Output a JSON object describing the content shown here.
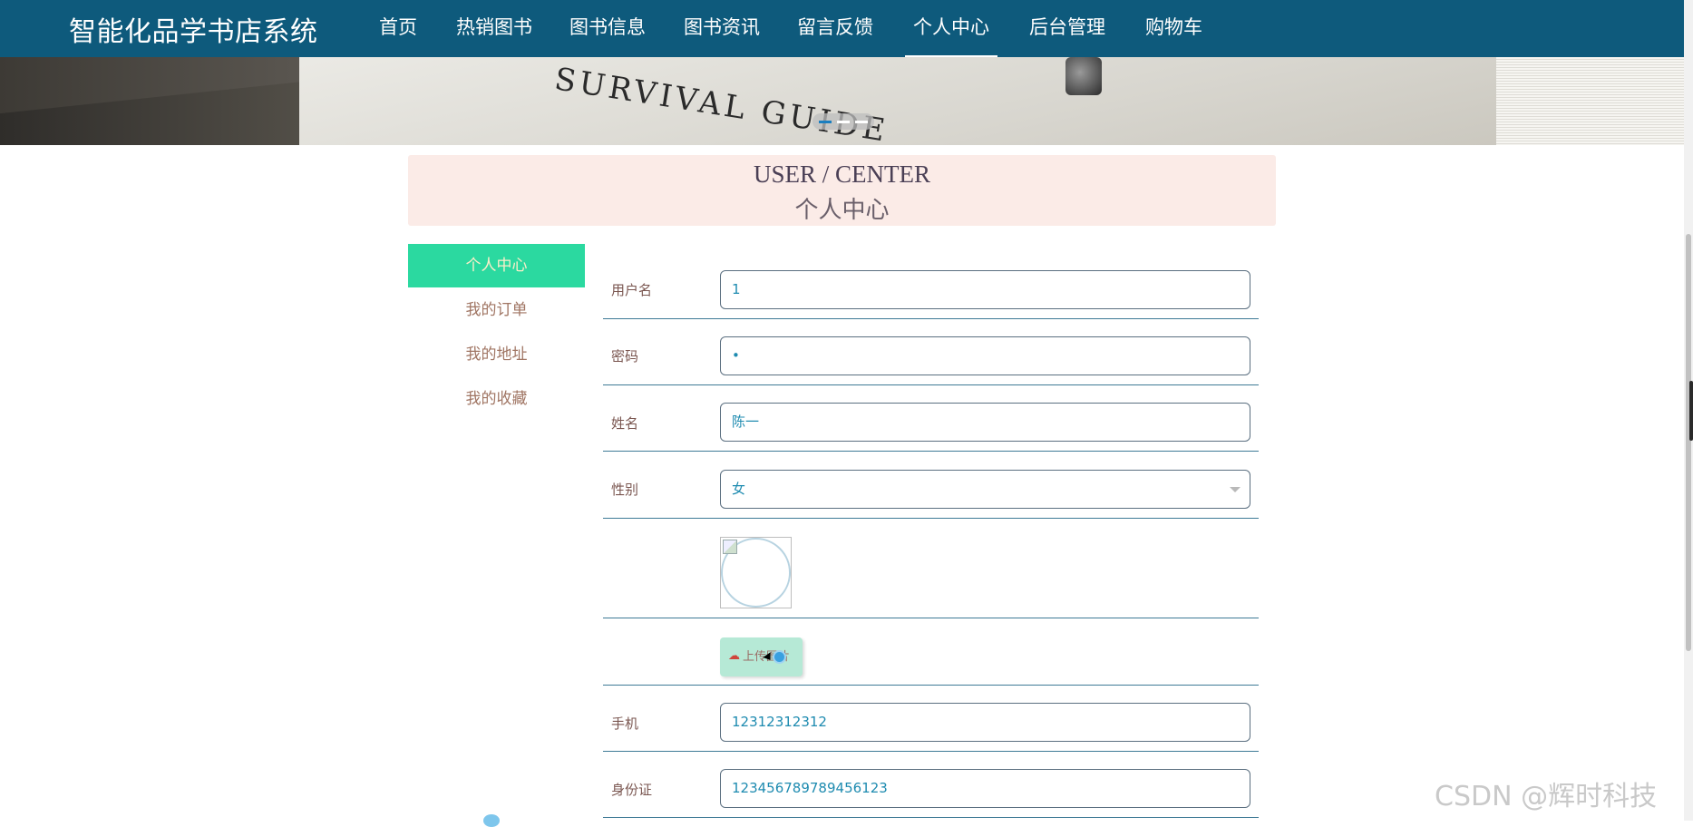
{
  "site": {
    "title": "智能化品学书店系统"
  },
  "nav": {
    "items": [
      {
        "label": "首页",
        "active": false
      },
      {
        "label": "热销图书",
        "active": false
      },
      {
        "label": "图书信息",
        "active": false
      },
      {
        "label": "图书资讯",
        "active": false
      },
      {
        "label": "留言反馈",
        "active": false
      },
      {
        "label": "个人中心",
        "active": true
      },
      {
        "label": "后台管理",
        "active": false
      },
      {
        "label": "购物车",
        "active": false
      }
    ]
  },
  "banner": {
    "text": "SURVIVAL GUIDE",
    "active_slide": 1,
    "slide_count": 3
  },
  "header": {
    "title_en": "USER / CENTER",
    "title_cn": "个人中心"
  },
  "menu": {
    "items": [
      {
        "label": "个人中心",
        "active": true
      },
      {
        "label": "我的订单",
        "active": false
      },
      {
        "label": "我的地址",
        "active": false
      },
      {
        "label": "我的收藏",
        "active": false
      }
    ]
  },
  "form": {
    "username": {
      "label": "用户名",
      "value": "1"
    },
    "password": {
      "label": "密码",
      "value": "•"
    },
    "name": {
      "label": "姓名",
      "value": "陈一"
    },
    "gender": {
      "label": "性别",
      "value": "女"
    },
    "upload": {
      "label": "上传图片"
    },
    "phone": {
      "label": "手机",
      "value": "12312312312"
    },
    "id_card": {
      "label": "身份证",
      "value": "123456789789456123"
    }
  },
  "watermark": "CSDN @辉时科技",
  "colors": {
    "nav_bg": "#0e5a7c",
    "active_menu": "#2bd9a0",
    "header_bg": "#fbebe7"
  }
}
